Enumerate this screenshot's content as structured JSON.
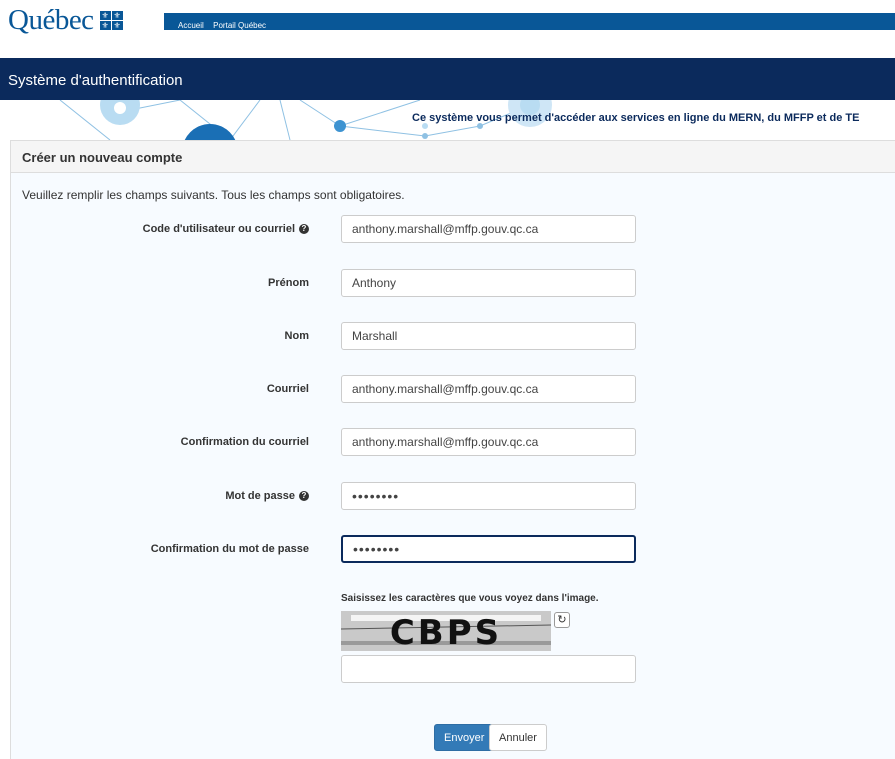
{
  "header": {
    "logo_text": "Québec",
    "flag_symbol": "⚜",
    "nav_links": [
      "Accueil",
      "Portail Québec"
    ],
    "brand_color": "#095797"
  },
  "banner": {
    "title": "Système d'authentification",
    "message": "Ce système vous permet d'accéder aux services en ligne du MERN, du MFFP et de TE",
    "color": "#0b2a5c"
  },
  "form": {
    "heading": "Créer un nouveau compte",
    "intro": "Veuillez remplir les champs suivants. Tous les champs sont obligatoires.",
    "fields": {
      "username": {
        "label": "Code d'utilisateur ou courriel",
        "value": "anthony.marshall@mffp.gouv.qc.ca",
        "help_icon": "question-circle-icon"
      },
      "firstname": {
        "label": "Prénom",
        "value": "Anthony"
      },
      "lastname": {
        "label": "Nom",
        "value": "Marshall"
      },
      "email": {
        "label": "Courriel",
        "value": "anthony.marshall@mffp.gouv.qc.ca"
      },
      "email_confirm": {
        "label": "Confirmation du courriel",
        "value": "anthony.marshall@mffp.gouv.qc.ca"
      },
      "password": {
        "label": "Mot de passe",
        "value": "••••••••",
        "help_icon": "question-circle-icon"
      },
      "password_confirm": {
        "label": "Confirmation du mot de passe",
        "value": "••••••••"
      }
    },
    "captcha": {
      "label": "Saisissez les caractères que vous voyez dans l'image.",
      "image_text": "CBPS",
      "refresh_icon": "refresh-icon",
      "value": ""
    },
    "buttons": {
      "submit": "Envoyer",
      "cancel": "Annuler"
    },
    "primary_color": "#337ab7"
  }
}
